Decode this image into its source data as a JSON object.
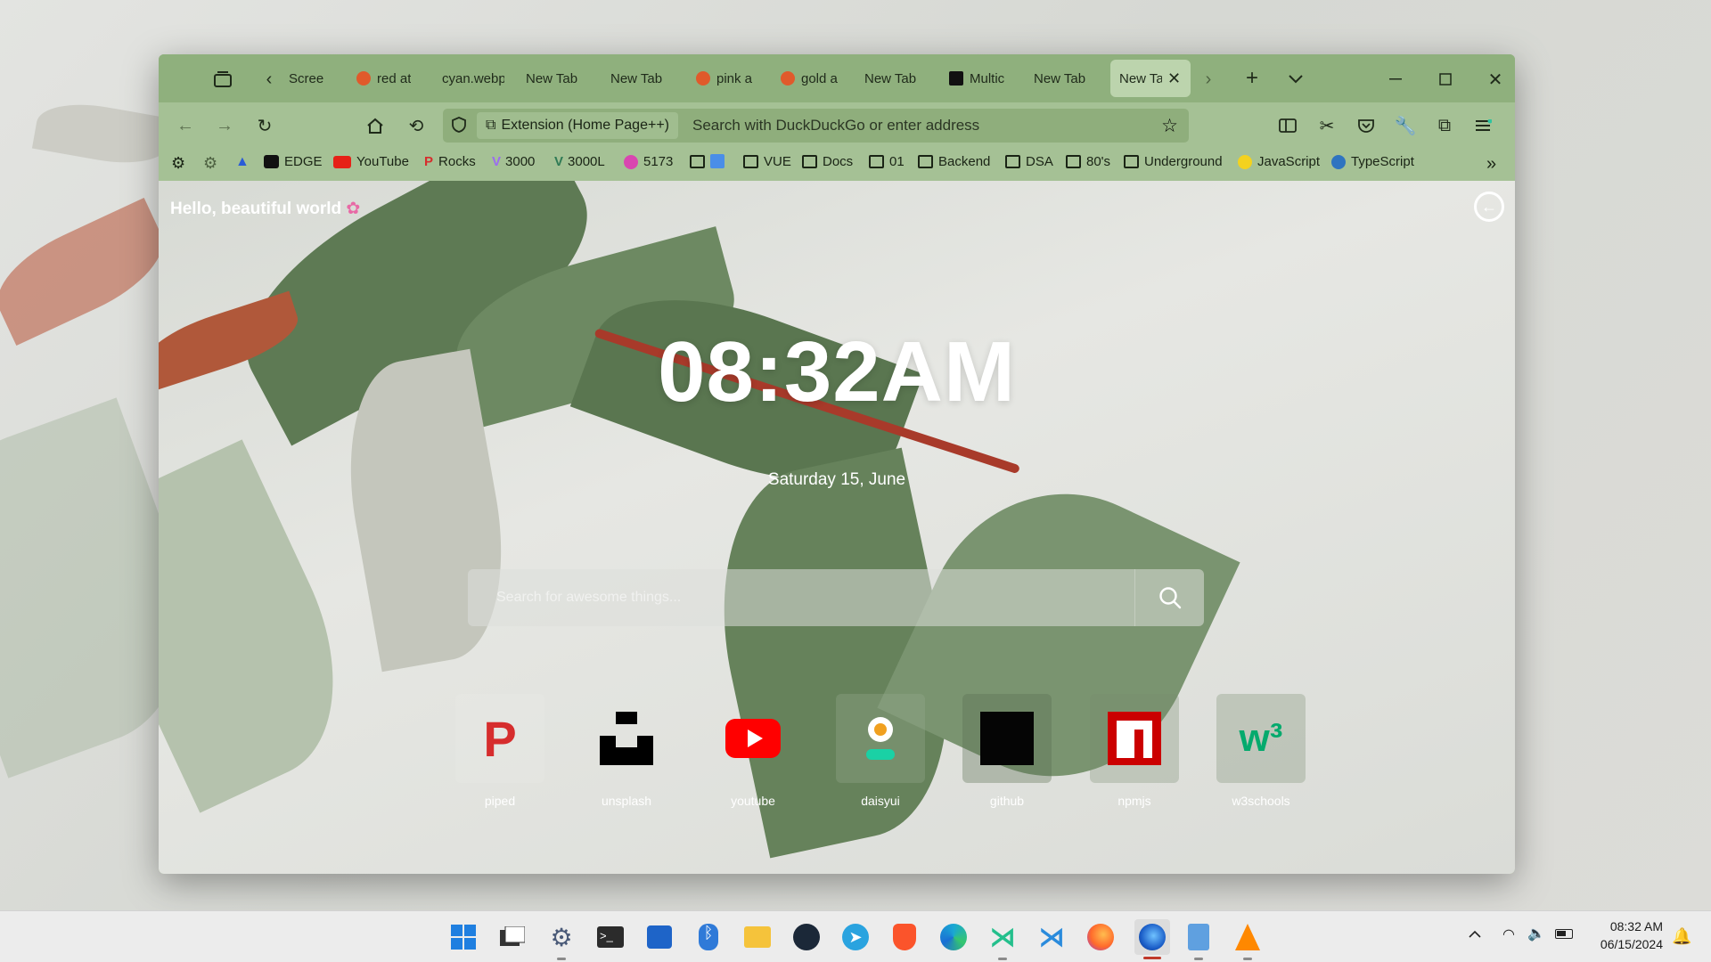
{
  "tabs": [
    {
      "label": "Scree",
      "favicon_color": ""
    },
    {
      "label": "red at",
      "favicon_color": "#e05a2b"
    },
    {
      "label": "cyan.webp",
      "favicon_color": ""
    },
    {
      "label": "New Tab",
      "favicon_color": ""
    },
    {
      "label": "New Tab",
      "favicon_color": ""
    },
    {
      "label": "pink a",
      "favicon_color": "#e05a2b"
    },
    {
      "label": "gold a",
      "favicon_color": "#e05a2b"
    },
    {
      "label": "New Tab",
      "favicon_color": ""
    },
    {
      "label": "Multic",
      "favicon_color": "#111111"
    },
    {
      "label": "New Tab",
      "favicon_color": ""
    },
    {
      "label": "New Ta",
      "favicon_color": "",
      "active": true
    }
  ],
  "urlbar": {
    "extension_label": "Extension (Home Page++)",
    "placeholder": "Search with DuckDuckGo or enter address"
  },
  "bookmarks": [
    {
      "label": "",
      "icon": "gear-icon"
    },
    {
      "label": "",
      "icon": "settings-cog-icon"
    },
    {
      "label": "",
      "icon": "flask-icon"
    },
    {
      "label": "EDGE",
      "icon": "edge-square-icon"
    },
    {
      "label": "YouTube",
      "icon": "youtube-icon"
    },
    {
      "label": "Rocks",
      "icon": "piped-icon"
    },
    {
      "label": "3000",
      "icon": "vite-icon"
    },
    {
      "label": "3000L",
      "icon": "vue-icon"
    },
    {
      "label": "5173",
      "icon": "app-icon"
    },
    {
      "label": "",
      "icon": "folder-icon"
    },
    {
      "label": "VUE",
      "icon": "folder-icon"
    },
    {
      "label": "Docs",
      "icon": "folder-icon"
    },
    {
      "label": "01",
      "icon": "folder-icon"
    },
    {
      "label": "Backend",
      "icon": "folder-icon"
    },
    {
      "label": "DSA",
      "icon": "folder-icon"
    },
    {
      "label": "80's",
      "icon": "folder-icon"
    },
    {
      "label": "Underground",
      "icon": "folder-icon"
    },
    {
      "label": "JavaScript",
      "icon": "javascript-icon"
    },
    {
      "label": "TypeScript",
      "icon": "typescript-icon"
    }
  ],
  "page": {
    "greeting": "Hello, beautiful world",
    "time": "08:32AM",
    "date": "Saturday 15, June",
    "search_placeholder": "Search for awesome things...",
    "shortcuts": [
      {
        "label": "piped",
        "color": "#d62d2d"
      },
      {
        "label": "unsplash",
        "color": "#000000"
      },
      {
        "label": "youtube",
        "color": "#ff0000"
      },
      {
        "label": "daisyui",
        "color": "#f0a020"
      },
      {
        "label": "github",
        "color": "#000000"
      },
      {
        "label": "npmjs",
        "color": "#cb0000"
      },
      {
        "label": "w3schools",
        "color": "#04aa6d"
      }
    ]
  },
  "taskbar": {
    "apps": [
      "windows-start-icon",
      "task-view-icon",
      "settings-icon",
      "terminal-icon",
      "store-icon",
      "bluetooth-icon",
      "file-explorer-icon",
      "steam-icon",
      "telegram-icon",
      "brave-icon",
      "edge-beta-icon",
      "vscode-insiders-icon",
      "vscode-icon",
      "firefox-icon",
      "firefox-dev-icon",
      "notepad-icon",
      "vlc-icon"
    ],
    "time": "08:32 AM",
    "date": "06/15/2024"
  },
  "colors": {
    "chrome_green": "#8fb07d",
    "toolbar_green": "#a5c195",
    "active_tab": "#bcd4ad"
  }
}
